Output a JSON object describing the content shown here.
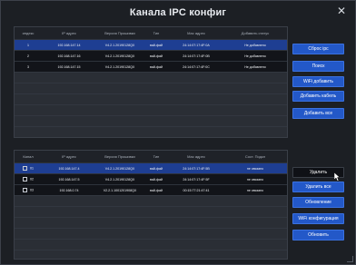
{
  "window": {
    "title": "Канала IPC конфиг",
    "close_glyph": "✕"
  },
  "top_table": {
    "columns": [
      "индекс",
      "IP адрес",
      "Версия Прошивки",
      "Тип",
      "Mac адрес",
      "Добавить статус"
    ],
    "rows": [
      [
        "1",
        "192.168.147.14",
        "V4.2.1.20190128QX",
        "вай-фай",
        "24:14:07:17:4F:0A",
        "Не добавлено"
      ],
      [
        "2",
        "192.168.147.16",
        "V4.2.1.20190128QX",
        "вай-фай",
        "24:14:07:17:4F:0B",
        "Не добавлено"
      ],
      [
        "3",
        "192.168.147.15",
        "V4.2.1.20190128QX",
        "вай-фай",
        "24:14:07:17:4F:0C",
        "Не добавлено"
      ]
    ]
  },
  "bottom_table": {
    "columns": [
      "Канал",
      "IP адрес",
      "Версия Прошивки",
      "Тип",
      "Mac адрес",
      "Сост. Подкл"
    ],
    "rows": [
      [
        "01",
        "192.168.147.4",
        "V4.2.1.20190128QX",
        "вай-фай",
        "24:14:07:17:4F:5B",
        "не связано"
      ],
      [
        "02",
        "192.168.147.5",
        "V4.2.1.20190128QX",
        "вай-фай",
        "24:14:07:17:4F:5F",
        "не связано"
      ],
      [
        "03",
        "192.168.0.74",
        "V2.2.1.1001201908QX",
        "вай-фай",
        "00:15:77:21:47:41",
        "не связано"
      ]
    ]
  },
  "buttons": {
    "reset_ipc": "Сброс ipc",
    "search": "Поиск",
    "wifi_add": "WiFi добавить",
    "add_cable": "Добавить кабель",
    "add_all": "Добавить все",
    "delete": "Удалить",
    "delete_all": "Удалить все",
    "update": "Обновление",
    "wifi_config": "WiFi конфигурация",
    "refresh": "Обновить"
  },
  "colors": {
    "accent": "#2358c8",
    "selected_row": "#1e3e92"
  }
}
